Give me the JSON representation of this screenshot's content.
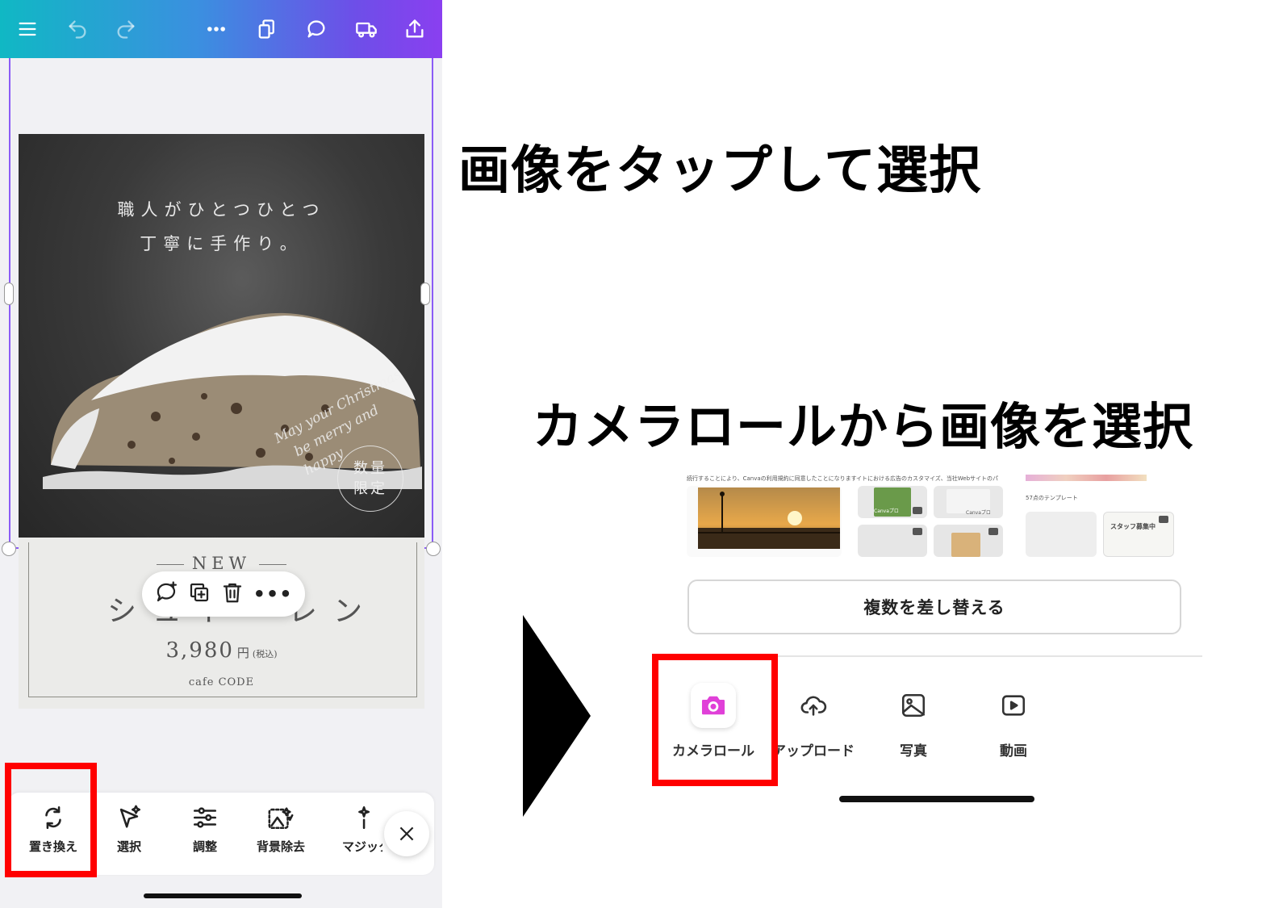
{
  "captions": {
    "step1": "画像をタップして選択",
    "step2": "カメラロールから画像を選択"
  },
  "poster": {
    "headline_line1": "職人がひとつひとつ",
    "headline_line2": "丁寧に手作り。",
    "script_line1": "May your Christmas",
    "script_line2": "be merry and happy",
    "badge_text": "数量限定",
    "new_label": "NEW",
    "product_name": "シュトーレン",
    "price": "3,980",
    "price_unit": "円",
    "price_tax": "(税込)",
    "shop": "cafe CODE"
  },
  "bottom_toolbar": {
    "items": [
      {
        "label": "置き換え",
        "icon": "replace-icon"
      },
      {
        "label": "選択",
        "icon": "magic-select-icon"
      },
      {
        "label": "調整",
        "icon": "sliders-icon"
      },
      {
        "label": "背景除去",
        "icon": "background-remover-icon"
      },
      {
        "label": "マジック",
        "icon": "magic-icon"
      }
    ]
  },
  "right_panel": {
    "thumb_captions": [
      "続行することにより、Canvaの利用規約に同意したことになります",
      "イトにおける広告のカスタマイズ、当社Webサイトのパ",
      "57点のテンプレート"
    ],
    "thumb_labels": [
      "Canvaプロ",
      "Canvaプロ",
      "スタッフ募集中"
    ],
    "replace_multiple_label": "複数を差し替える",
    "sources": [
      {
        "label": "カメラロール",
        "icon": "camera-icon",
        "accent": "#e040d8"
      },
      {
        "label": "アップロード",
        "icon": "cloud-upload-icon"
      },
      {
        "label": "写真",
        "icon": "photo-icon"
      },
      {
        "label": "動画",
        "icon": "video-icon"
      }
    ]
  },
  "colors": {
    "topbar_gradient_start": "#10b8c4",
    "topbar_gradient_end": "#8a3ff0",
    "selection": "#8b5cf6",
    "highlight": "#ff0000",
    "camera_accent": "#e040d8"
  }
}
